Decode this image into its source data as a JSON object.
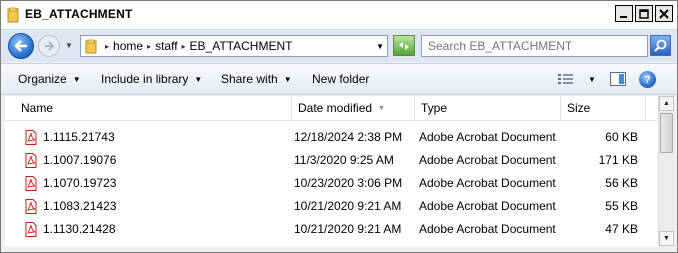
{
  "window": {
    "title": "EB_ATTACHMENT",
    "minimize_icon": "minimize-icon",
    "maximize_icon": "maximize-icon",
    "close_icon": "close-icon"
  },
  "address": {
    "crumbs": [
      "home",
      "staff",
      "EB_ATTACHMENT"
    ],
    "search_placeholder": "Search EB_ATTACHMENT"
  },
  "toolbar": {
    "organize": "Organize",
    "include_in_library": "Include in library",
    "share_with": "Share with",
    "new_folder": "New folder"
  },
  "columns": {
    "name": "Name",
    "date_modified": "Date modified",
    "type": "Type",
    "size": "Size"
  },
  "files": [
    {
      "name": "1.1115.21743",
      "date": "12/18/2024 2:38 PM",
      "type": "Adobe Acrobat Document",
      "size": "60 KB"
    },
    {
      "name": "1.1007.19076",
      "date": "11/3/2020 9:25 AM",
      "type": "Adobe Acrobat Document",
      "size": "171 KB"
    },
    {
      "name": "1.1070.19723",
      "date": "10/23/2020 3:06 PM",
      "type": "Adobe Acrobat Document",
      "size": "56 KB"
    },
    {
      "name": "1.1083.21423",
      "date": "10/21/2020 9:21 AM",
      "type": "Adobe Acrobat Document",
      "size": "55 KB"
    },
    {
      "name": "1.1130.21428",
      "date": "10/21/2020 9:21 AM",
      "type": "Adobe Acrobat Document",
      "size": "47 KB"
    }
  ],
  "colors": {
    "address_bg": "#dde6f2",
    "pdf_red": "#d9261c",
    "folder_yellow": "#f4c64e"
  }
}
